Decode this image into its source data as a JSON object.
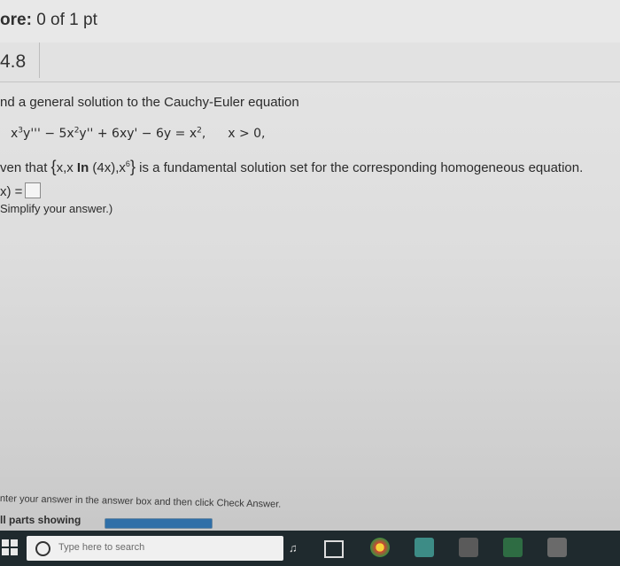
{
  "header": {
    "score_label": "ore:",
    "score_value": "0 of 1 pt"
  },
  "question": {
    "number": "4.8"
  },
  "problem": {
    "intro": "nd a general solution to the Cauchy-Euler equation",
    "equation": {
      "t1": "x",
      "t1_sup": "3",
      "t2": "y''' − 5x",
      "t2_sup": "2",
      "t3": "y'' + 6xy' − 6y = x",
      "t3_sup": "2",
      "t4": ",",
      "condition": "x > 0,"
    },
    "given_prefix": "ven that ",
    "fundamental_set": {
      "open": "{",
      "x": "x,x ",
      "ln": "In",
      "arg": " (4x),x",
      "sup": "6",
      "close": "}"
    },
    "given_suffix": " is a fundamental solution set for the corresponding homogeneous equation.",
    "answer_label": "x) =",
    "hint": "Simplify your answer.)"
  },
  "footer": {
    "instruction": "nter your answer in the answer box and then click Check Answer.",
    "parts_label": "ll parts showing",
    "progress_fraction": 1.0
  },
  "taskbar": {
    "search_placeholder": "Type here to search",
    "icons": [
      "windows-icon",
      "search-icon",
      "microphone-icon",
      "task-view-icon",
      "chrome-icon",
      "photos-icon",
      "store-icon",
      "app-icon"
    ]
  },
  "colors": {
    "text": "#2b2b2b",
    "taskbar": "#1f2a2e",
    "progress": "#2f6fa8"
  }
}
